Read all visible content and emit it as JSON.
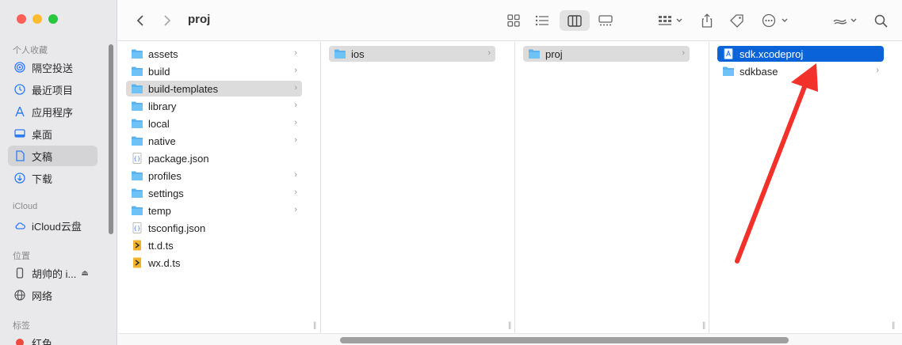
{
  "window": {
    "title": "proj"
  },
  "sidebar": {
    "sections": [
      {
        "label": "个人收藏"
      },
      {
        "label": "iCloud"
      },
      {
        "label": "位置"
      },
      {
        "label": "标签"
      }
    ],
    "favorites": [
      {
        "label": "隔空投送",
        "icon": "airdrop-icon"
      },
      {
        "label": "最近项目",
        "icon": "clock-icon"
      },
      {
        "label": "应用程序",
        "icon": "apps-icon"
      },
      {
        "label": "桌面",
        "icon": "desktop-icon"
      },
      {
        "label": "文稿",
        "icon": "document-icon",
        "active": true
      },
      {
        "label": "下载",
        "icon": "download-icon"
      }
    ],
    "icloud": [
      {
        "label": "iCloud云盘",
        "icon": "cloud-icon"
      }
    ],
    "locations": [
      {
        "label": "胡帅的 i...",
        "icon": "phone-icon"
      },
      {
        "label": "网络",
        "icon": "network-icon"
      }
    ],
    "tags": [
      {
        "label": "红色",
        "color": "#f04a3e"
      }
    ]
  },
  "toolbar": {
    "back_icon": "chevron-left-icon",
    "forward_icon": "chevron-right-icon",
    "views": [
      "grid-view",
      "list-view",
      "column-view",
      "gallery-view"
    ],
    "active_view": "column-view"
  },
  "columns": [
    {
      "items": [
        {
          "name": "assets",
          "type": "folder",
          "chevron": true
        },
        {
          "name": "build",
          "type": "folder",
          "chevron": true
        },
        {
          "name": "build-templates",
          "type": "folder",
          "chevron": true,
          "state": "highlighted"
        },
        {
          "name": "library",
          "type": "folder",
          "chevron": true
        },
        {
          "name": "local",
          "type": "folder",
          "chevron": true
        },
        {
          "name": "native",
          "type": "folder",
          "chevron": true
        },
        {
          "name": "package.json",
          "type": "json",
          "chevron": false
        },
        {
          "name": "profiles",
          "type": "folder",
          "chevron": true
        },
        {
          "name": "settings",
          "type": "folder",
          "chevron": true
        },
        {
          "name": "temp",
          "type": "folder",
          "chevron": true
        },
        {
          "name": "tsconfig.json",
          "type": "json",
          "chevron": false
        },
        {
          "name": "tt.d.ts",
          "type": "ts",
          "chevron": false
        },
        {
          "name": "wx.d.ts",
          "type": "ts",
          "chevron": false
        }
      ]
    },
    {
      "items": [
        {
          "name": "ios",
          "type": "folder",
          "chevron": true,
          "state": "highlighted"
        }
      ]
    },
    {
      "items": [
        {
          "name": "proj",
          "type": "folder",
          "chevron": true,
          "state": "highlighted"
        }
      ]
    },
    {
      "items": [
        {
          "name": "sdk.xcodeproj",
          "type": "xcodeproj",
          "chevron": false,
          "state": "selected"
        },
        {
          "name": "sdkbase",
          "type": "folder",
          "chevron": true
        }
      ]
    }
  ],
  "colors": {
    "selection": "#0a63d9",
    "highlight": "#dcdcdc",
    "folder": "#5ab3ee",
    "annotation_arrow": "#f2312b"
  }
}
